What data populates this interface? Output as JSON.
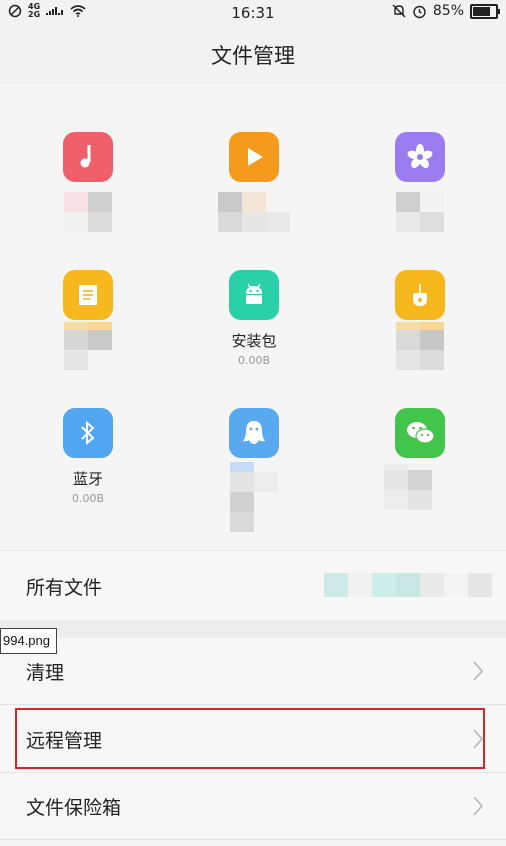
{
  "status": {
    "net_top": "4G",
    "net_bottom": "2G",
    "time": "16:31",
    "battery": "85%",
    "battery_level": 0.85
  },
  "header": {
    "title": "文件管理"
  },
  "categories": [
    {
      "icon": "music-note-icon",
      "color": "#f0606b"
    },
    {
      "icon": "play-icon",
      "color": "#f59a1b"
    },
    {
      "icon": "flower-icon",
      "color": "#9b7cf0"
    },
    {
      "icon": "document-icon",
      "color": "#f7b81d"
    },
    {
      "icon": "android-icon",
      "color": "#2ad0a8",
      "label": "安装包",
      "size": "0.00B"
    },
    {
      "icon": "usb-drive-icon",
      "color": "#f7b81d"
    },
    {
      "icon": "bluetooth-icon",
      "color": "#51a6f2",
      "label": "蓝牙",
      "size": "0.00B"
    },
    {
      "icon": "qq-penguin-icon",
      "color": "#59a9f0"
    },
    {
      "icon": "wechat-icon",
      "color": "#43c44a"
    }
  ],
  "all_files": {
    "label": "所有文件"
  },
  "tooltip": {
    "text": "994.png"
  },
  "menu": [
    {
      "label": "清理"
    },
    {
      "label": "远程管理"
    },
    {
      "label": "文件保险箱"
    }
  ]
}
